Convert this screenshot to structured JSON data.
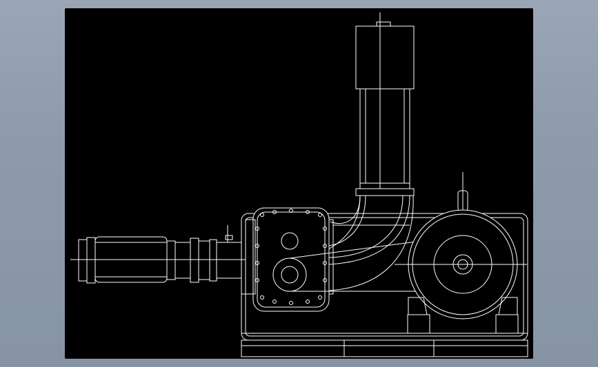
{
  "colors": {
    "background": "#8e9aab",
    "viewport": "#000000",
    "linework": "#ffffff"
  },
  "drawing": {
    "components": [
      "motor",
      "inlet-pipe",
      "elbow",
      "blower-casing",
      "drive-wheel",
      "belt",
      "outlet-silencer",
      "base-frame"
    ]
  }
}
